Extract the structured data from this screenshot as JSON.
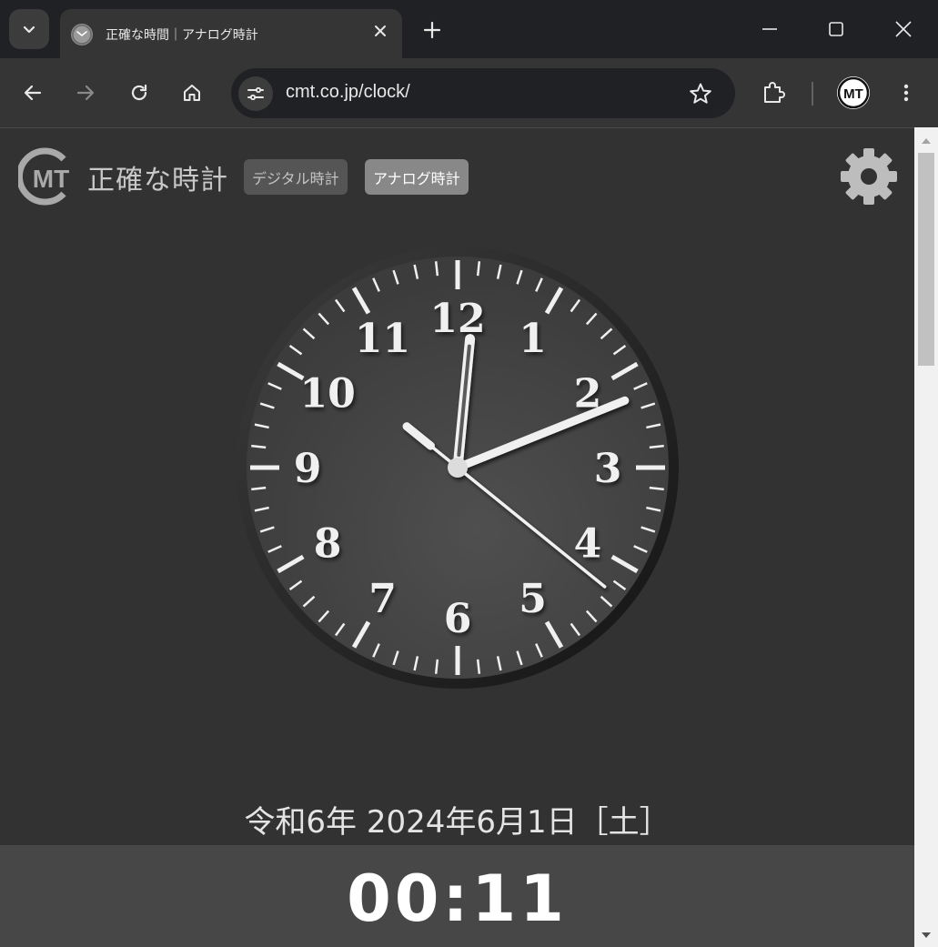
{
  "browser": {
    "tab_title": "正確な時間｜アナログ時計",
    "url": "cmt.co.jp/clock/",
    "profile_label": "MT",
    "icons": {
      "tab_search": "chevron-down-icon",
      "favicon": "clock-icon",
      "tab_close": "close-icon",
      "new_tab": "plus-icon",
      "minimize": "minimize-icon",
      "maximize": "maximize-icon",
      "close_window": "close-icon",
      "back": "arrow-left-icon",
      "forward": "arrow-right-icon",
      "reload": "reload-icon",
      "home": "home-icon",
      "site_info": "tune-icon",
      "bookmark": "star-icon",
      "extensions": "puzzle-icon",
      "menu": "more-vert-icon"
    }
  },
  "header": {
    "logo_text": "MT",
    "site_name": "正確な時計",
    "nav": [
      {
        "label": "デジタル時計",
        "active": false
      },
      {
        "label": "アナログ時計",
        "active": true
      }
    ],
    "settings_icon": "gear-icon"
  },
  "clock": {
    "numerals": [
      "12",
      "1",
      "2",
      "3",
      "4",
      "5",
      "6",
      "7",
      "8",
      "9",
      "10",
      "11"
    ],
    "hour": 0,
    "minute": 11,
    "second": 21.5,
    "colors": {
      "face": "#454545",
      "rim": "#2a2a2a",
      "markings": "#f0f0f0",
      "hands": "#f0f0f0"
    }
  },
  "date_text": "令和6年 2024年6月1日［土］",
  "time_text": "00:11",
  "colors": {
    "page_bg": "#323232",
    "time_bar_bg": "#474747",
    "active_nav": "#888888",
    "inactive_nav": "#555555"
  }
}
